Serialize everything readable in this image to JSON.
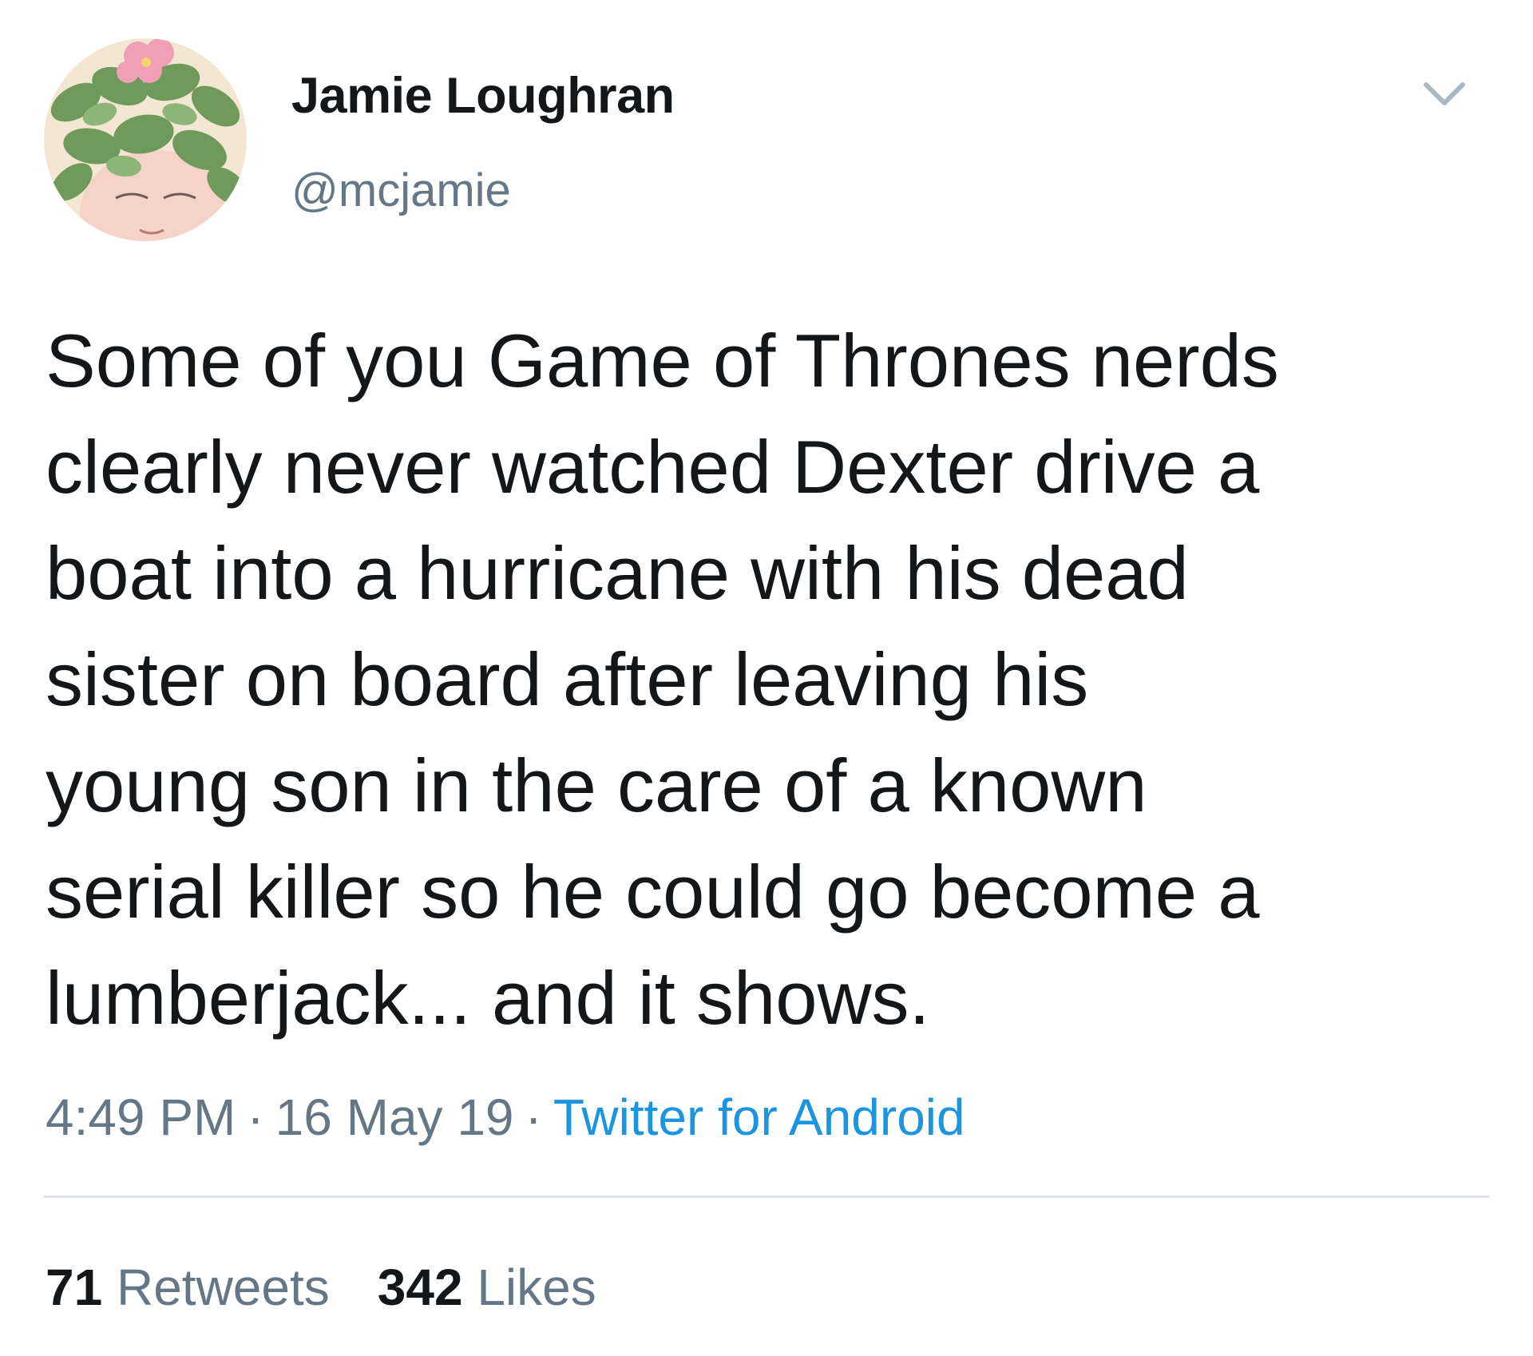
{
  "author": {
    "display_name": "Jamie Loughran",
    "handle": "@mcjamie",
    "avatar_icon": "avatar-leaf-crown-illustration"
  },
  "tweet": {
    "text_lines": [
      "Some of you Game of Thrones nerds",
      "clearly never watched Dexter drive a",
      "boat into a hurricane with his dead",
      "sister on board after leaving his",
      "young son in the care of a known",
      "serial killer so he could go become a",
      "lumberjack... and it shows."
    ],
    "time": "4:49 PM",
    "date": "16 May 19",
    "separator": "·",
    "source": "Twitter for Android"
  },
  "stats": {
    "retweets_count": "71",
    "retweets_label": "Retweets",
    "likes_count": "342",
    "likes_label": "Likes"
  },
  "colors": {
    "text": "#14171a",
    "secondary": "#657786",
    "link": "#1b95e0",
    "divider": "#dde3e8"
  },
  "icons": {
    "menu": "chevron-down-icon"
  }
}
